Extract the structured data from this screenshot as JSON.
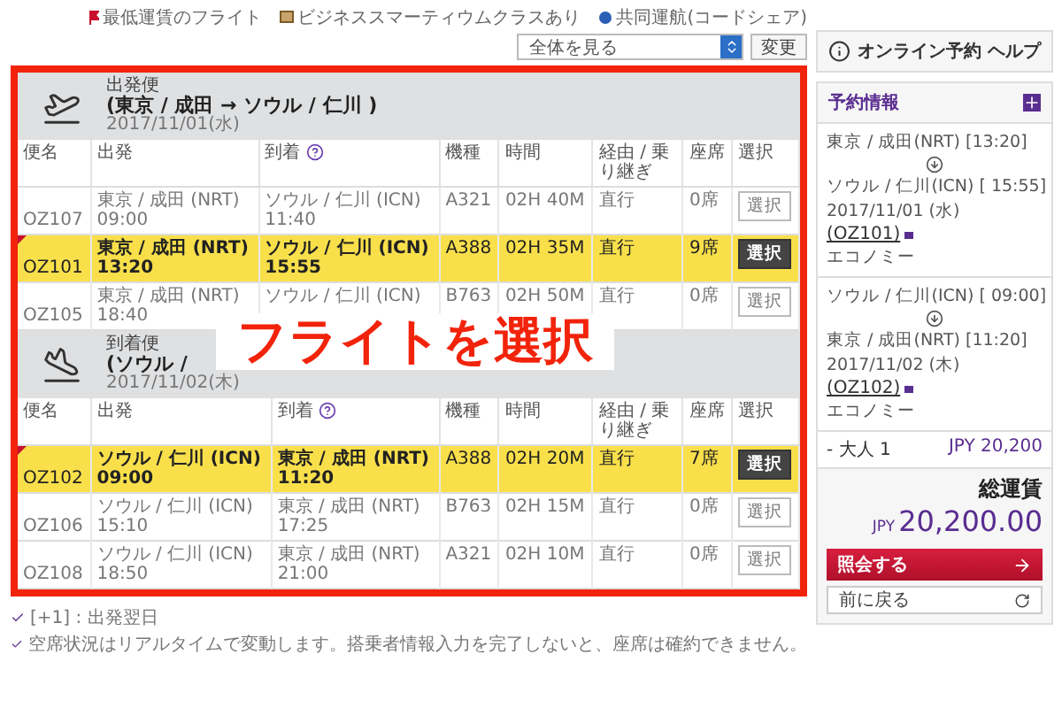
{
  "legend": [
    {
      "kind": "lowest",
      "label": "最低運賃のフライト"
    },
    {
      "kind": "business",
      "label": "ビジネススマーティウムクラスあり"
    },
    {
      "kind": "codeshare",
      "label": "共同運航(コードシェア)"
    }
  ],
  "filter": {
    "value": "全体を見る",
    "button": "変更"
  },
  "sections": [
    {
      "kind": "departure",
      "label": "出発便",
      "route": "(東京 / 成田 → ソウル / 仁川 )",
      "date": "2017/11/01(水)",
      "columns": [
        {
          "label": "便名",
          "help": false
        },
        {
          "label": "出発",
          "help": false
        },
        {
          "label": "到着",
          "help": true
        },
        {
          "label": "機種",
          "help": false
        },
        {
          "label": "時間",
          "help": false
        },
        {
          "label": "経由 / 乗り継ぎ",
          "help": false
        },
        {
          "label": "座席",
          "help": false
        },
        {
          "label": "選択",
          "help": false
        }
      ],
      "flights": [
        {
          "flight": "OZ107",
          "lowest_fare": false,
          "selected": false,
          "dep_place": "東京 / 成田 (NRT)",
          "dep_time": "09:00",
          "arr_place": "ソウル / 仁川 (ICN)",
          "arr_time": "11:40",
          "aircraft": "A321",
          "duration": "02H 40M",
          "via": "直行",
          "seats": "0席",
          "button": "選択"
        },
        {
          "flight": "OZ101",
          "lowest_fare": true,
          "selected": true,
          "dep_place": "東京 / 成田 (NRT)",
          "dep_time": "13:20",
          "arr_place": "ソウル / 仁川 (ICN)",
          "arr_time": "15:55",
          "aircraft": "A388",
          "duration": "02H 35M",
          "via": "直行",
          "seats": "9席",
          "button": "選択"
        },
        {
          "flight": "OZ105",
          "lowest_fare": false,
          "selected": false,
          "dep_place": "東京 / 成田 (NRT)",
          "dep_time": "18:40",
          "arr_place": "ソウル / 仁川 (ICN)",
          "aircraft": "B763",
          "duration": "02H 50M",
          "via": "直行",
          "seats": "0席",
          "button": "選択"
        }
      ]
    },
    {
      "kind": "arrival",
      "label": "到着便",
      "route": "(ソウル /",
      "date": "2017/11/02(木)",
      "columns": [
        {
          "label": "便名",
          "help": false
        },
        {
          "label": "出発",
          "help": false
        },
        {
          "label": "到着",
          "help": true
        },
        {
          "label": "機種",
          "help": false
        },
        {
          "label": "時間",
          "help": false
        },
        {
          "label": "経由 / 乗り継ぎ",
          "help": false
        },
        {
          "label": "座席",
          "help": false
        },
        {
          "label": "選択",
          "help": false
        }
      ],
      "flights": [
        {
          "flight": "OZ102",
          "lowest_fare": true,
          "selected": true,
          "dep_place": "ソウル / 仁川 (ICN)",
          "dep_time": "09:00",
          "arr_place": "東京 / 成田 (NRT)",
          "arr_time": "11:20",
          "aircraft": "A388",
          "duration": "02H 20M",
          "via": "直行",
          "seats": "7席",
          "button": "選択"
        },
        {
          "flight": "OZ106",
          "lowest_fare": false,
          "selected": false,
          "dep_place": "ソウル / 仁川 (ICN)",
          "dep_time": "15:10",
          "arr_place": "東京 / 成田 (NRT)",
          "arr_time": "17:25",
          "aircraft": "B763",
          "duration": "02H 15M",
          "via": "直行",
          "seats": "0席",
          "button": "選択"
        },
        {
          "flight": "OZ108",
          "lowest_fare": false,
          "selected": false,
          "dep_place": "ソウル / 仁川 (ICN)",
          "dep_time": "18:50",
          "arr_place": "東京 / 成田 (NRT)",
          "arr_time": "21:00",
          "aircraft": "A321",
          "duration": "02H 10M",
          "via": "直行",
          "seats": "0席",
          "button": "選択"
        }
      ]
    }
  ],
  "annotation": {
    "text": "フライトを選択"
  },
  "notes": [
    "[+1] : 出発翌日",
    "空席状況はリアルタイムで変動します。搭乗者情報入力を完了しないと、座席は確約できません。"
  ],
  "sidebar": {
    "help_button": "オンライン予約 ヘルプ",
    "title": "予約情報",
    "segments": [
      {
        "from": "東京 / 成田(NRT) [13:20]",
        "to": "ソウル / 仁川(ICN) [ 15:55]",
        "date": "2017/11/01 (水)",
        "flight": "(OZ101)",
        "cabin": "エコノミー"
      },
      {
        "from": "ソウル / 仁川(ICN) [ 09:00]",
        "to": "東京 / 成田(NRT) [11:20]",
        "date": "2017/11/02 (木)",
        "flight": "(OZ102)",
        "cabin": "エコノミー"
      }
    ],
    "fare": {
      "label": "- 大人 1",
      "amount": "JPY 20,200"
    },
    "total": {
      "label": "総運賃",
      "currency": "JPY",
      "amount": "20,200.00"
    },
    "next_button": "照会する",
    "back_button": "前に戻る"
  }
}
